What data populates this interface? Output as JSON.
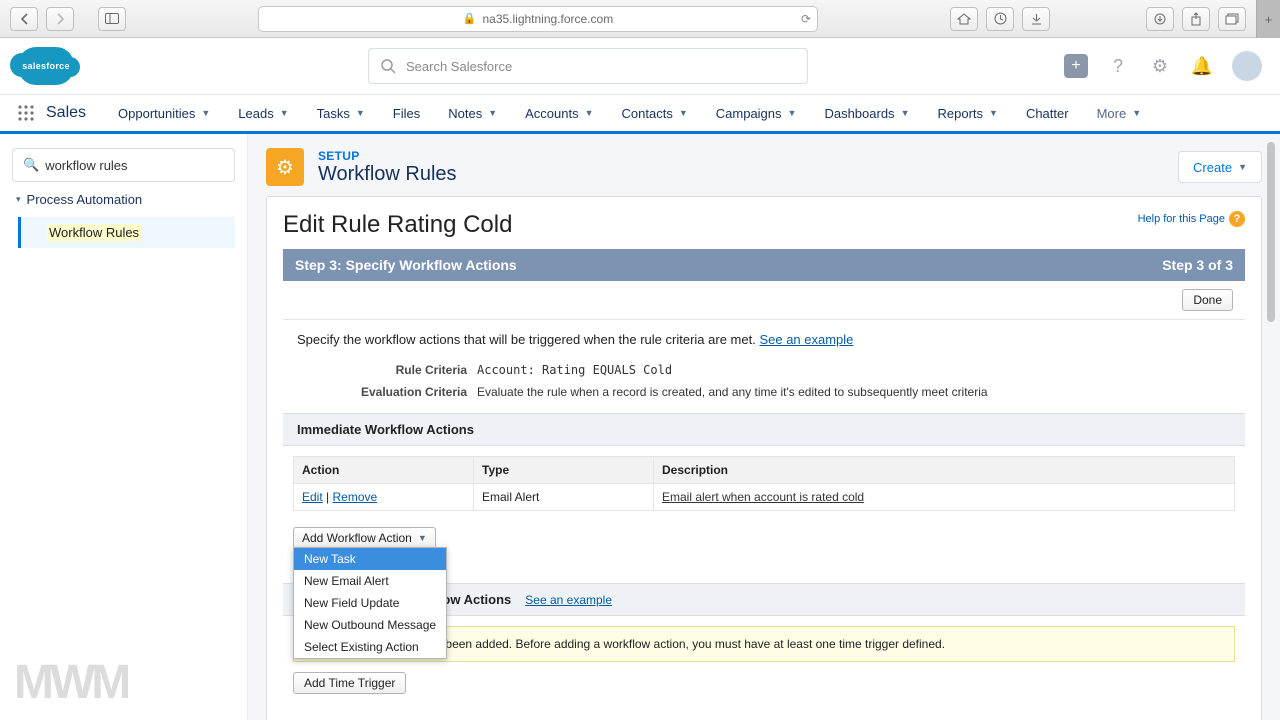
{
  "browser": {
    "url": "na35.lightning.force.com"
  },
  "header": {
    "cloud_text": "salesforce",
    "search_placeholder": "Search Salesforce"
  },
  "nav": {
    "app": "Sales",
    "items": [
      "Opportunities",
      "Leads",
      "Tasks",
      "Files",
      "Notes",
      "Accounts",
      "Contacts",
      "Campaigns",
      "Dashboards",
      "Reports",
      "Chatter",
      "More"
    ],
    "dropdowns": [
      true,
      true,
      true,
      false,
      true,
      true,
      true,
      true,
      true,
      true,
      false,
      true
    ]
  },
  "sidebar": {
    "quickfind": "workflow rules",
    "group": "Process Automation",
    "child": "Workflow Rules"
  },
  "setup": {
    "label": "SETUP",
    "page": "Workflow Rules",
    "create": "Create"
  },
  "card": {
    "title": "Edit Rule Rating Cold",
    "help": "Help for this Page",
    "step_left": "Step 3: Specify Workflow Actions",
    "step_right": "Step 3 of 3",
    "done": "Done",
    "instr": "Specify the workflow actions that will be triggered when the rule criteria are met.",
    "see_example": "See an example",
    "rule_crit_label": "Rule Criteria",
    "rule_crit_val": "Account: Rating EQUALS Cold",
    "eval_crit_label": "Evaluation Criteria",
    "eval_crit_val": "Evaluate the rule when a record is created, and any time it's edited to subsequently meet criteria",
    "immediate_header": "Immediate Workflow Actions",
    "tbl_action": "Action",
    "tbl_type": "Type",
    "tbl_desc": "Description",
    "row_edit": "Edit",
    "row_remove": "Remove",
    "row_type": "Email Alert",
    "row_desc": "Email alert when account is rated cold",
    "add_action": "Add Workflow Action",
    "dd": {
      "i0": "New Task",
      "i1": "New Email Alert",
      "i2": "New Field Update",
      "i3": "New Outbound Message",
      "i4": "Select Existing Action"
    },
    "time_header": "Time-Dependent Workflow Actions",
    "warn": "No workflow actions have been added. Before adding a workflow action, you must have at least one time trigger defined.",
    "add_trigger": "Add Time Trigger"
  },
  "watermark": "MWM"
}
